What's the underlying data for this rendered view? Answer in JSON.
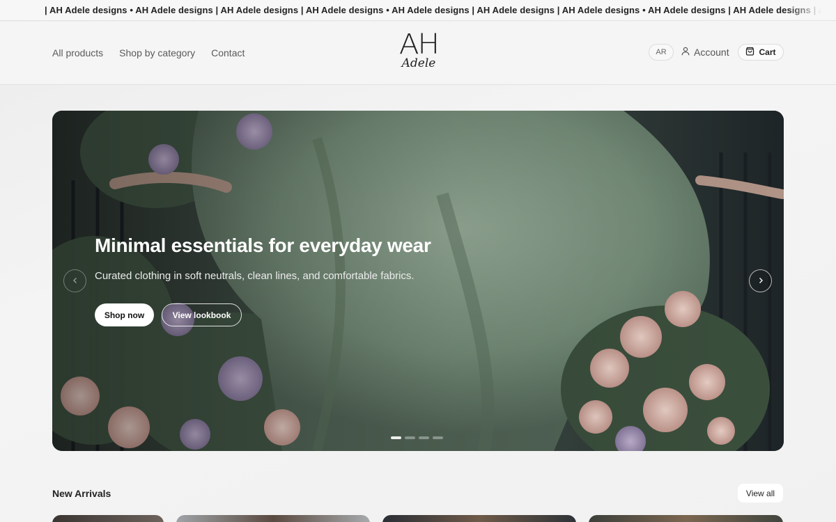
{
  "marquee": {
    "text": "| AH Adele designs • AH Adele designs | AH Adele designs | AH Adele designs • AH Adele designs | AH Adele designs | AH Adele designs • AH Adele designs | AH Adele designs | AH Adele designs"
  },
  "header": {
    "nav": [
      {
        "label": "All products"
      },
      {
        "label": "Shop by category"
      },
      {
        "label": "Contact"
      }
    ],
    "logo": {
      "top": "AH",
      "bottom": "Adele"
    },
    "lang_label": "AR",
    "account_label": "Account",
    "cart_label": "Cart"
  },
  "hero": {
    "title": "Minimal essentials for everyday wear",
    "subtitle": "Curated clothing in soft neutrals, clean lines, and comfortable fabrics.",
    "primary_cta": "Shop now",
    "secondary_cta": "View lookbook",
    "slide_count": 4,
    "active_slide": 1,
    "icons": {
      "prev": "chevron-left-icon",
      "next": "chevron-right-icon"
    }
  },
  "new_arrivals": {
    "title": "New Arrivals",
    "view_all_label": "View all"
  },
  "colors": {
    "accent": "#111111",
    "hero_green": "#6f8a73",
    "background": "#f2f2f2"
  }
}
